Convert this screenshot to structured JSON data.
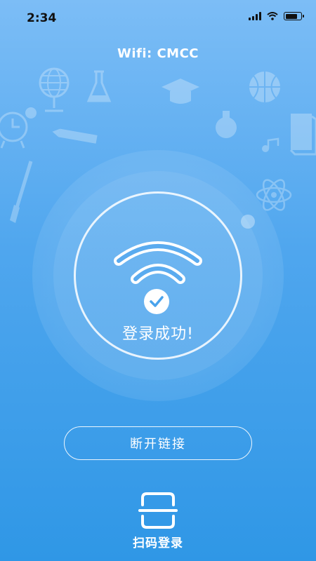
{
  "status_bar": {
    "time": "2:34",
    "battery_level": 0.8
  },
  "header": {
    "wifi_title": "Wifi: CMCC"
  },
  "main": {
    "success_text": "登录成功!"
  },
  "actions": {
    "disconnect_label": "断开链接",
    "scan_login_label": "扫码登录"
  },
  "colors": {
    "gradient_top": "#7cbdf6",
    "gradient_bottom": "#2f97e6",
    "foreground": "#ffffff"
  },
  "decorations": [
    "alarm-clock-icon",
    "globe-icon",
    "flask-icon",
    "graduation-cap-icon",
    "basketball-icon",
    "lightbulb-icon",
    "book-icon",
    "pencil-icon",
    "paintbrush-icon",
    "music-note-icon",
    "atom-icon"
  ]
}
